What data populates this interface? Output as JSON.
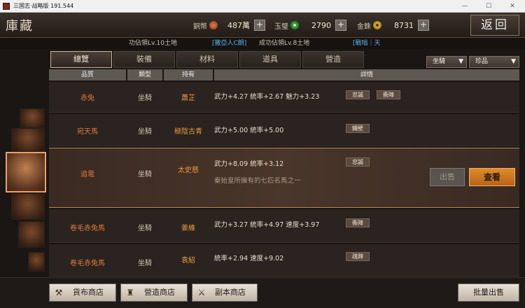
{
  "os": {
    "title": "三国志·战略版 191.544",
    "min": "—",
    "max": "☐",
    "close": "✕"
  },
  "header": {
    "title": "庫藏",
    "back_label": "返回"
  },
  "currency": [
    {
      "label": "銅幣",
      "value": "487萬",
      "color": "#b0502a"
    },
    {
      "label": "玉璧",
      "value": "2790",
      "color": "#3aa03a"
    },
    {
      "label": "金銖",
      "value": "8731",
      "color": "#d8a020"
    }
  ],
  "ticker": [
    {
      "text": "功佔領Lv.10土地",
      "color": "#cfc3ad"
    },
    {
      "text": "[撒亞人C朗]",
      "color": "#5ab0f0"
    },
    {
      "text": "成功佔領Lv.8土地",
      "color": "#cfc3ad"
    },
    {
      "text": "[戰嗡｜天",
      "color": "#5ab0f0"
    }
  ],
  "tabs": [
    "總覽",
    "裝備",
    "材料",
    "道具",
    "營造"
  ],
  "active_tab": 0,
  "filters": {
    "type": "坐騎",
    "rarity": "珍品"
  },
  "columns": [
    "品質",
    "類型",
    "持有",
    "詳情"
  ],
  "items": [
    {
      "name": "赤兔",
      "type": "坐騎",
      "owner": "蕭芷",
      "attrs": "武力+4.27  統率+2.67  魅力+3.23",
      "skills": [
        "忠誠",
        "衝陣"
      ]
    },
    {
      "name": "宛天馬",
      "type": "坐騎",
      "owner": "極陰古青",
      "attrs": "武力+5.00  統率+5.00",
      "skills": [
        "鐵壁"
      ]
    },
    {
      "name": "追電",
      "type": "坐騎",
      "owner": "太史慈",
      "attrs": "武力+8.09  統率+3.12",
      "skills": [
        "忠誠"
      ],
      "desc": "秦始皇所擁有的七匹名馬之一",
      "selected": true
    },
    {
      "name": "卷毛赤兔馬",
      "type": "坐騎",
      "owner": "姜維",
      "attrs": "武力+3.27  統率+4.97  速度+3.97",
      "skills": [
        "衝陣"
      ]
    },
    {
      "name": "卷毛赤兔馬",
      "type": "坐騎",
      "owner": "袁紹",
      "attrs": "統率+2.94  速度+9.02",
      "skills": [
        "疏蹄"
      ]
    }
  ],
  "actions": {
    "sell": "出售",
    "view": "查看"
  },
  "bottom": {
    "cloth_shop": "貨布商店",
    "build_shop": "營造商店",
    "dungeon_shop": "副本商店",
    "bulk_sell": "批量出售"
  }
}
